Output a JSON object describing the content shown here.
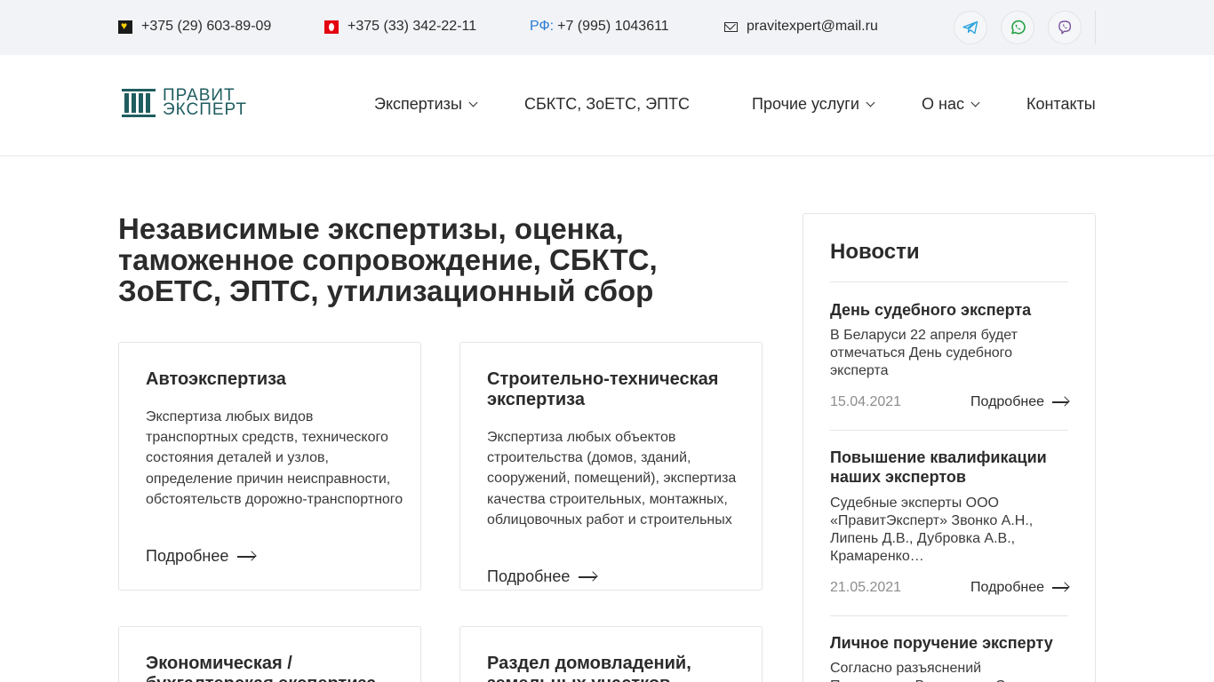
{
  "topbar": {
    "phone_life": "+375 (29) 603-89-09",
    "phone_mts": "+375 (33) 342-22-11",
    "rf_label": "РФ:",
    "phone_rf": "+7 (995) 1043611",
    "email": "pravitexpert@mail.ru",
    "social": [
      "telegram-icon",
      "whatsapp-icon",
      "viber-icon"
    ]
  },
  "header": {
    "logo_line1": "ПРАВИТ",
    "logo_line2": "ЭКСПЕРТ",
    "nav": [
      {
        "label": "Экспертизы",
        "dropdown": true
      },
      {
        "label": "СБКТС, ЗоЕТС, ЭПТС",
        "dropdown": false
      },
      {
        "label": "Прочие услуги",
        "dropdown": true
      },
      {
        "label": "О нас",
        "dropdown": true
      },
      {
        "label": "Контакты",
        "dropdown": false
      }
    ]
  },
  "main": {
    "title": "Независимые экспертизы, оценка, таможенное сопровождение, СБКТС, ЗоЕТС, ЭПТС, утилизационный сбор",
    "cards": [
      {
        "title": "Автоэкспертиза",
        "text": "Экспертиза любых видов транспортных средств, технического состояния деталей и узлов, определение причин неисправности, обстоятельств дорожно-транспортного происшествия.",
        "more": "Подробнее"
      },
      {
        "title": "Строительно-техническая экспертиза",
        "text": "Экспертиза любых объектов строительства (домов, зданий, сооружений, помещений), экспертиза качества строительных, монтажных, облицовочных работ и строительных проектов, а также",
        "more": "Подробнее"
      },
      {
        "title": "Экономическая / бухгалтерская экспертиза",
        "text": "",
        "more": ""
      },
      {
        "title": "Раздел домовладений, земельных участков",
        "text": "",
        "more": ""
      }
    ]
  },
  "news": {
    "heading": "Новости",
    "items": [
      {
        "title": "День судебного эксперта",
        "text": "В Беларуси 22 апреля будет отмечаться День судебного эксперта",
        "date": "15.04.2021",
        "more": "Подробнее"
      },
      {
        "title": "Повышение квалификации наших экспертов",
        "text": "Судебные эксперты ООО «ПравитЭксперт» Звонко А.Н., Липень Д.В., Дубровка А.В., Крамаренко…",
        "date": "21.05.2021",
        "more": "Подробнее"
      },
      {
        "title": "Личное поручение эксперту",
        "text": "Согласно разъяснений Президиума Верховного Суда",
        "date": "",
        "more": ""
      }
    ]
  },
  "colors": {
    "topbar_bg": "#f1f3f6",
    "brand": "#1f5d5f",
    "rf_accent": "#2a7bd4",
    "telegram": "#2aa3dc",
    "whatsapp": "#25a244",
    "viber": "#7b519d"
  }
}
